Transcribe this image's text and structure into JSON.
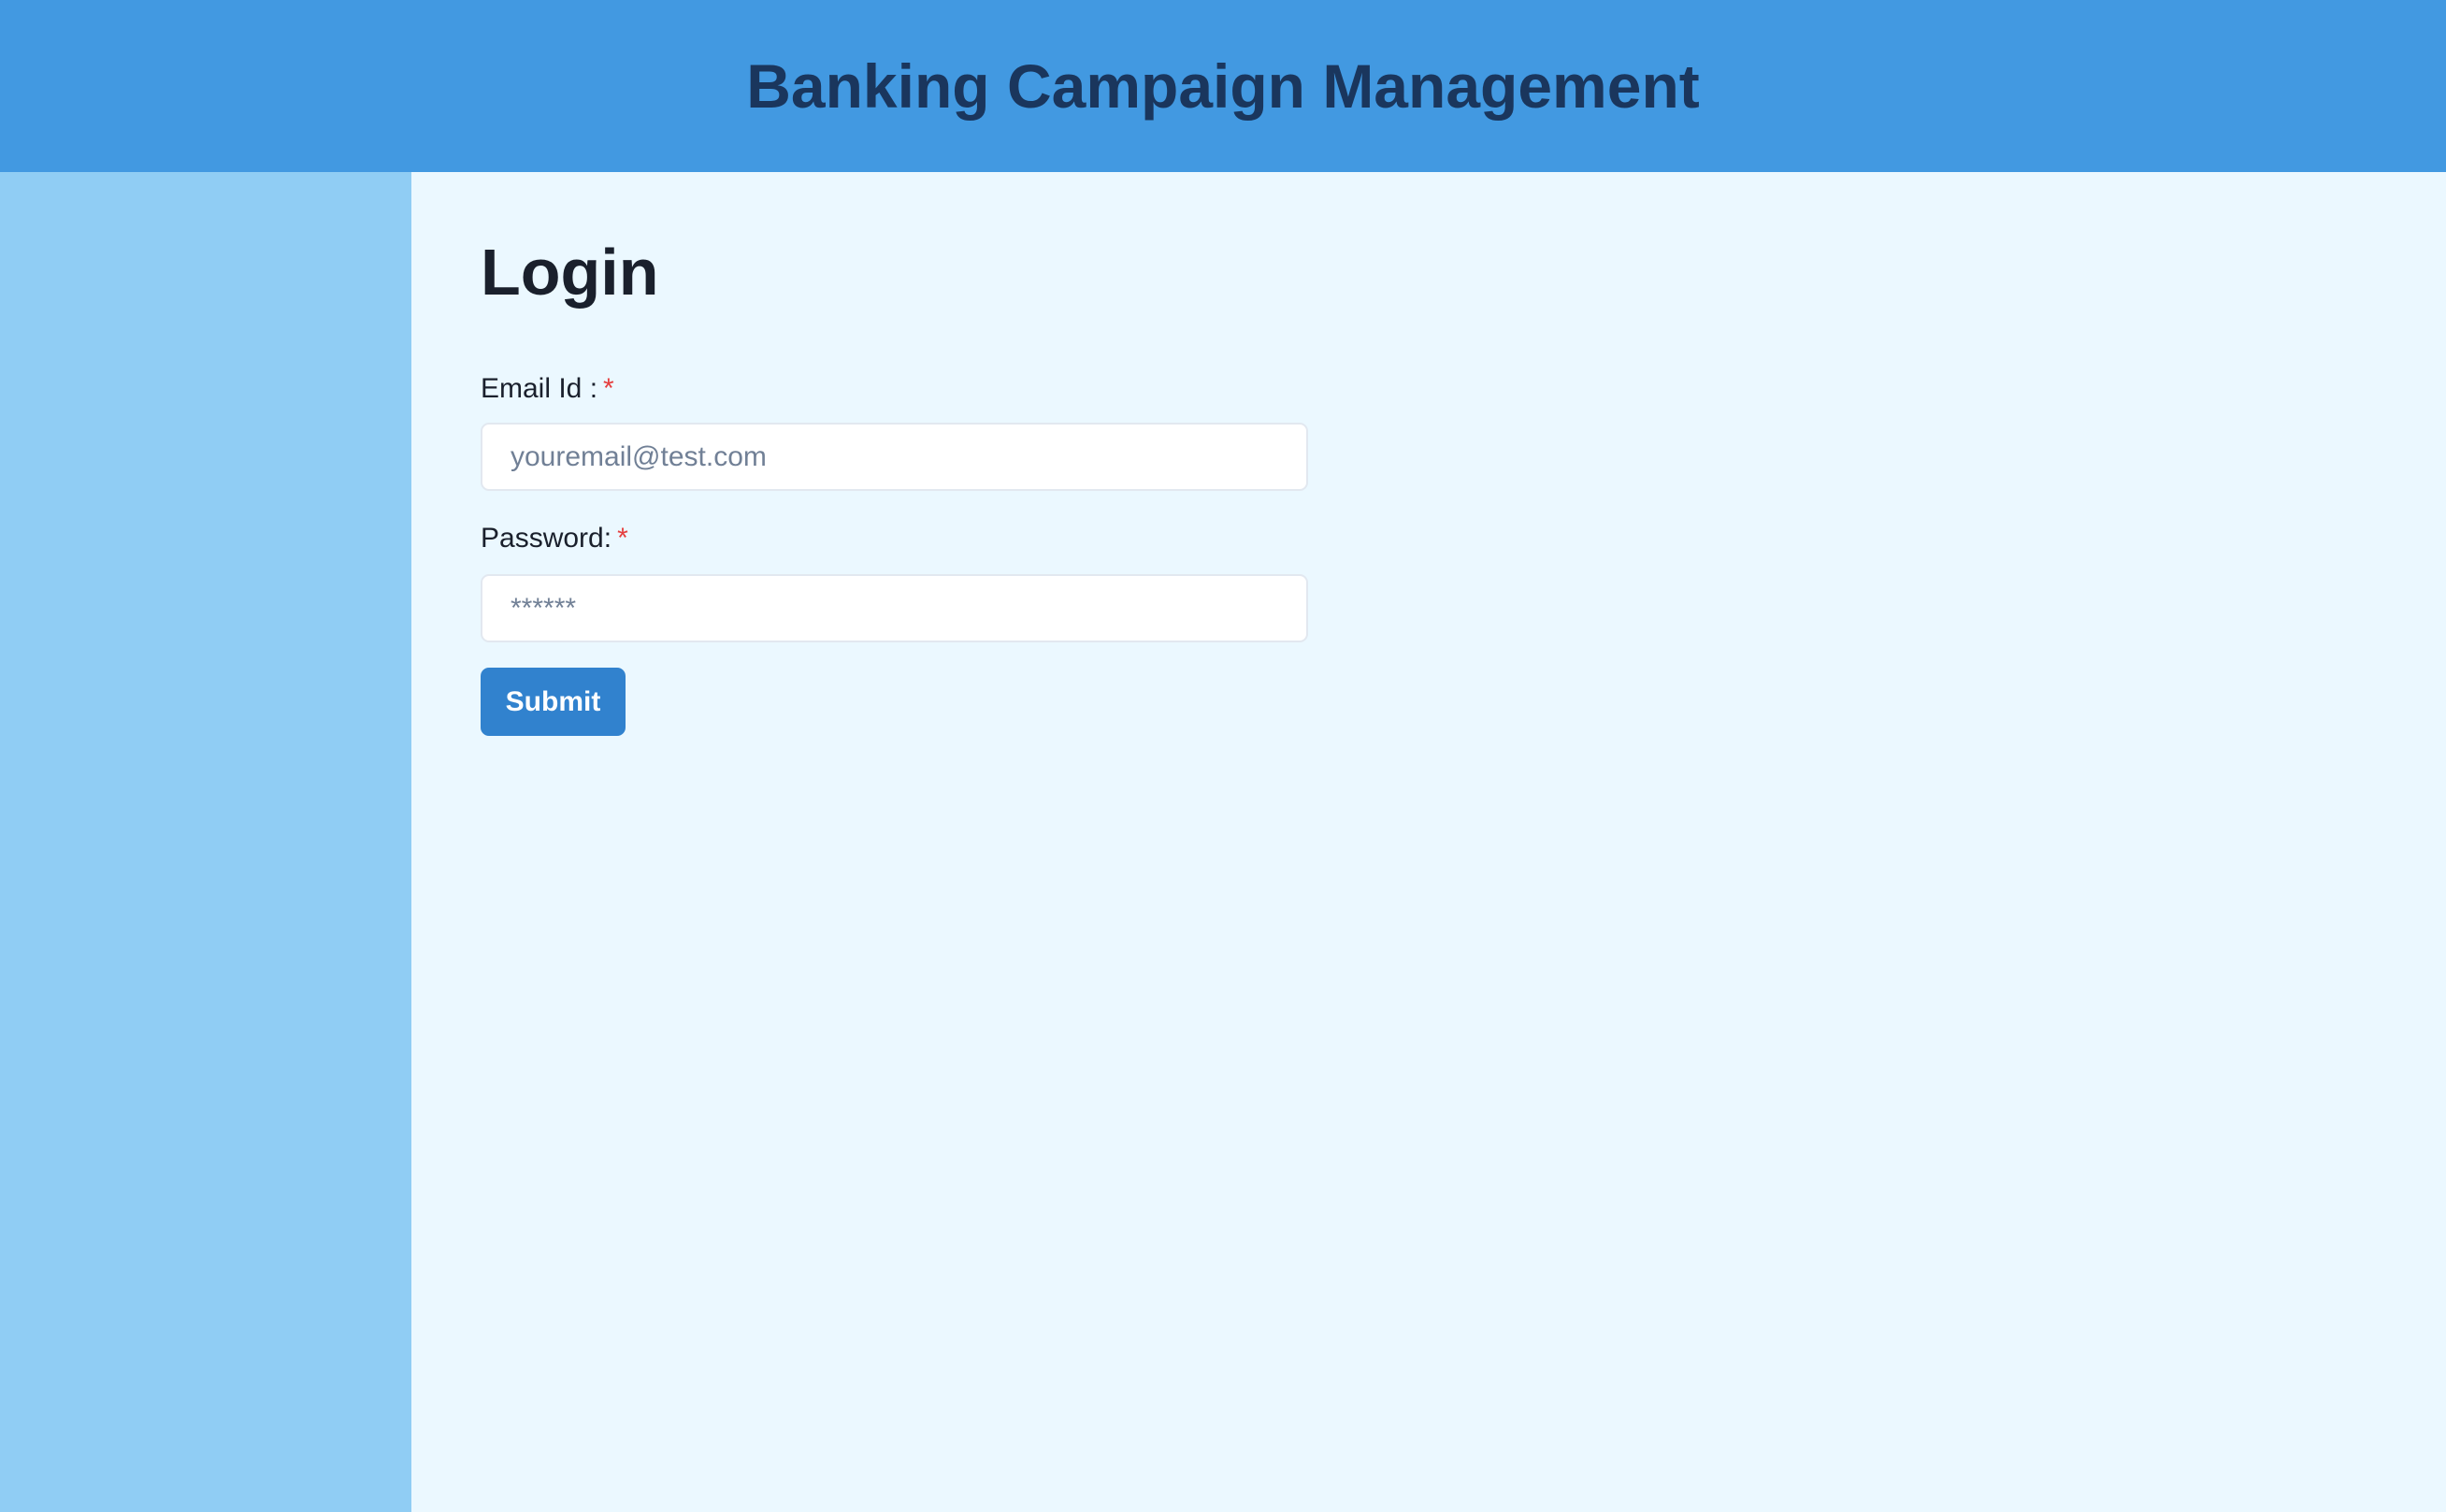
{
  "header": {
    "title": "Banking Campaign Management"
  },
  "login": {
    "title": "Login",
    "email": {
      "label": "Email Id :",
      "required_mark": "*",
      "placeholder": "youremail@test.com",
      "value": ""
    },
    "password": {
      "label": "Password:",
      "required_mark": "*",
      "placeholder": "******",
      "value": ""
    },
    "submit_label": "Submit"
  },
  "colors": {
    "header": "#4299e1",
    "sidebar": "#90cdf4",
    "main": "#ebf8ff",
    "button": "#3182ce",
    "required": "#e53e3e"
  }
}
